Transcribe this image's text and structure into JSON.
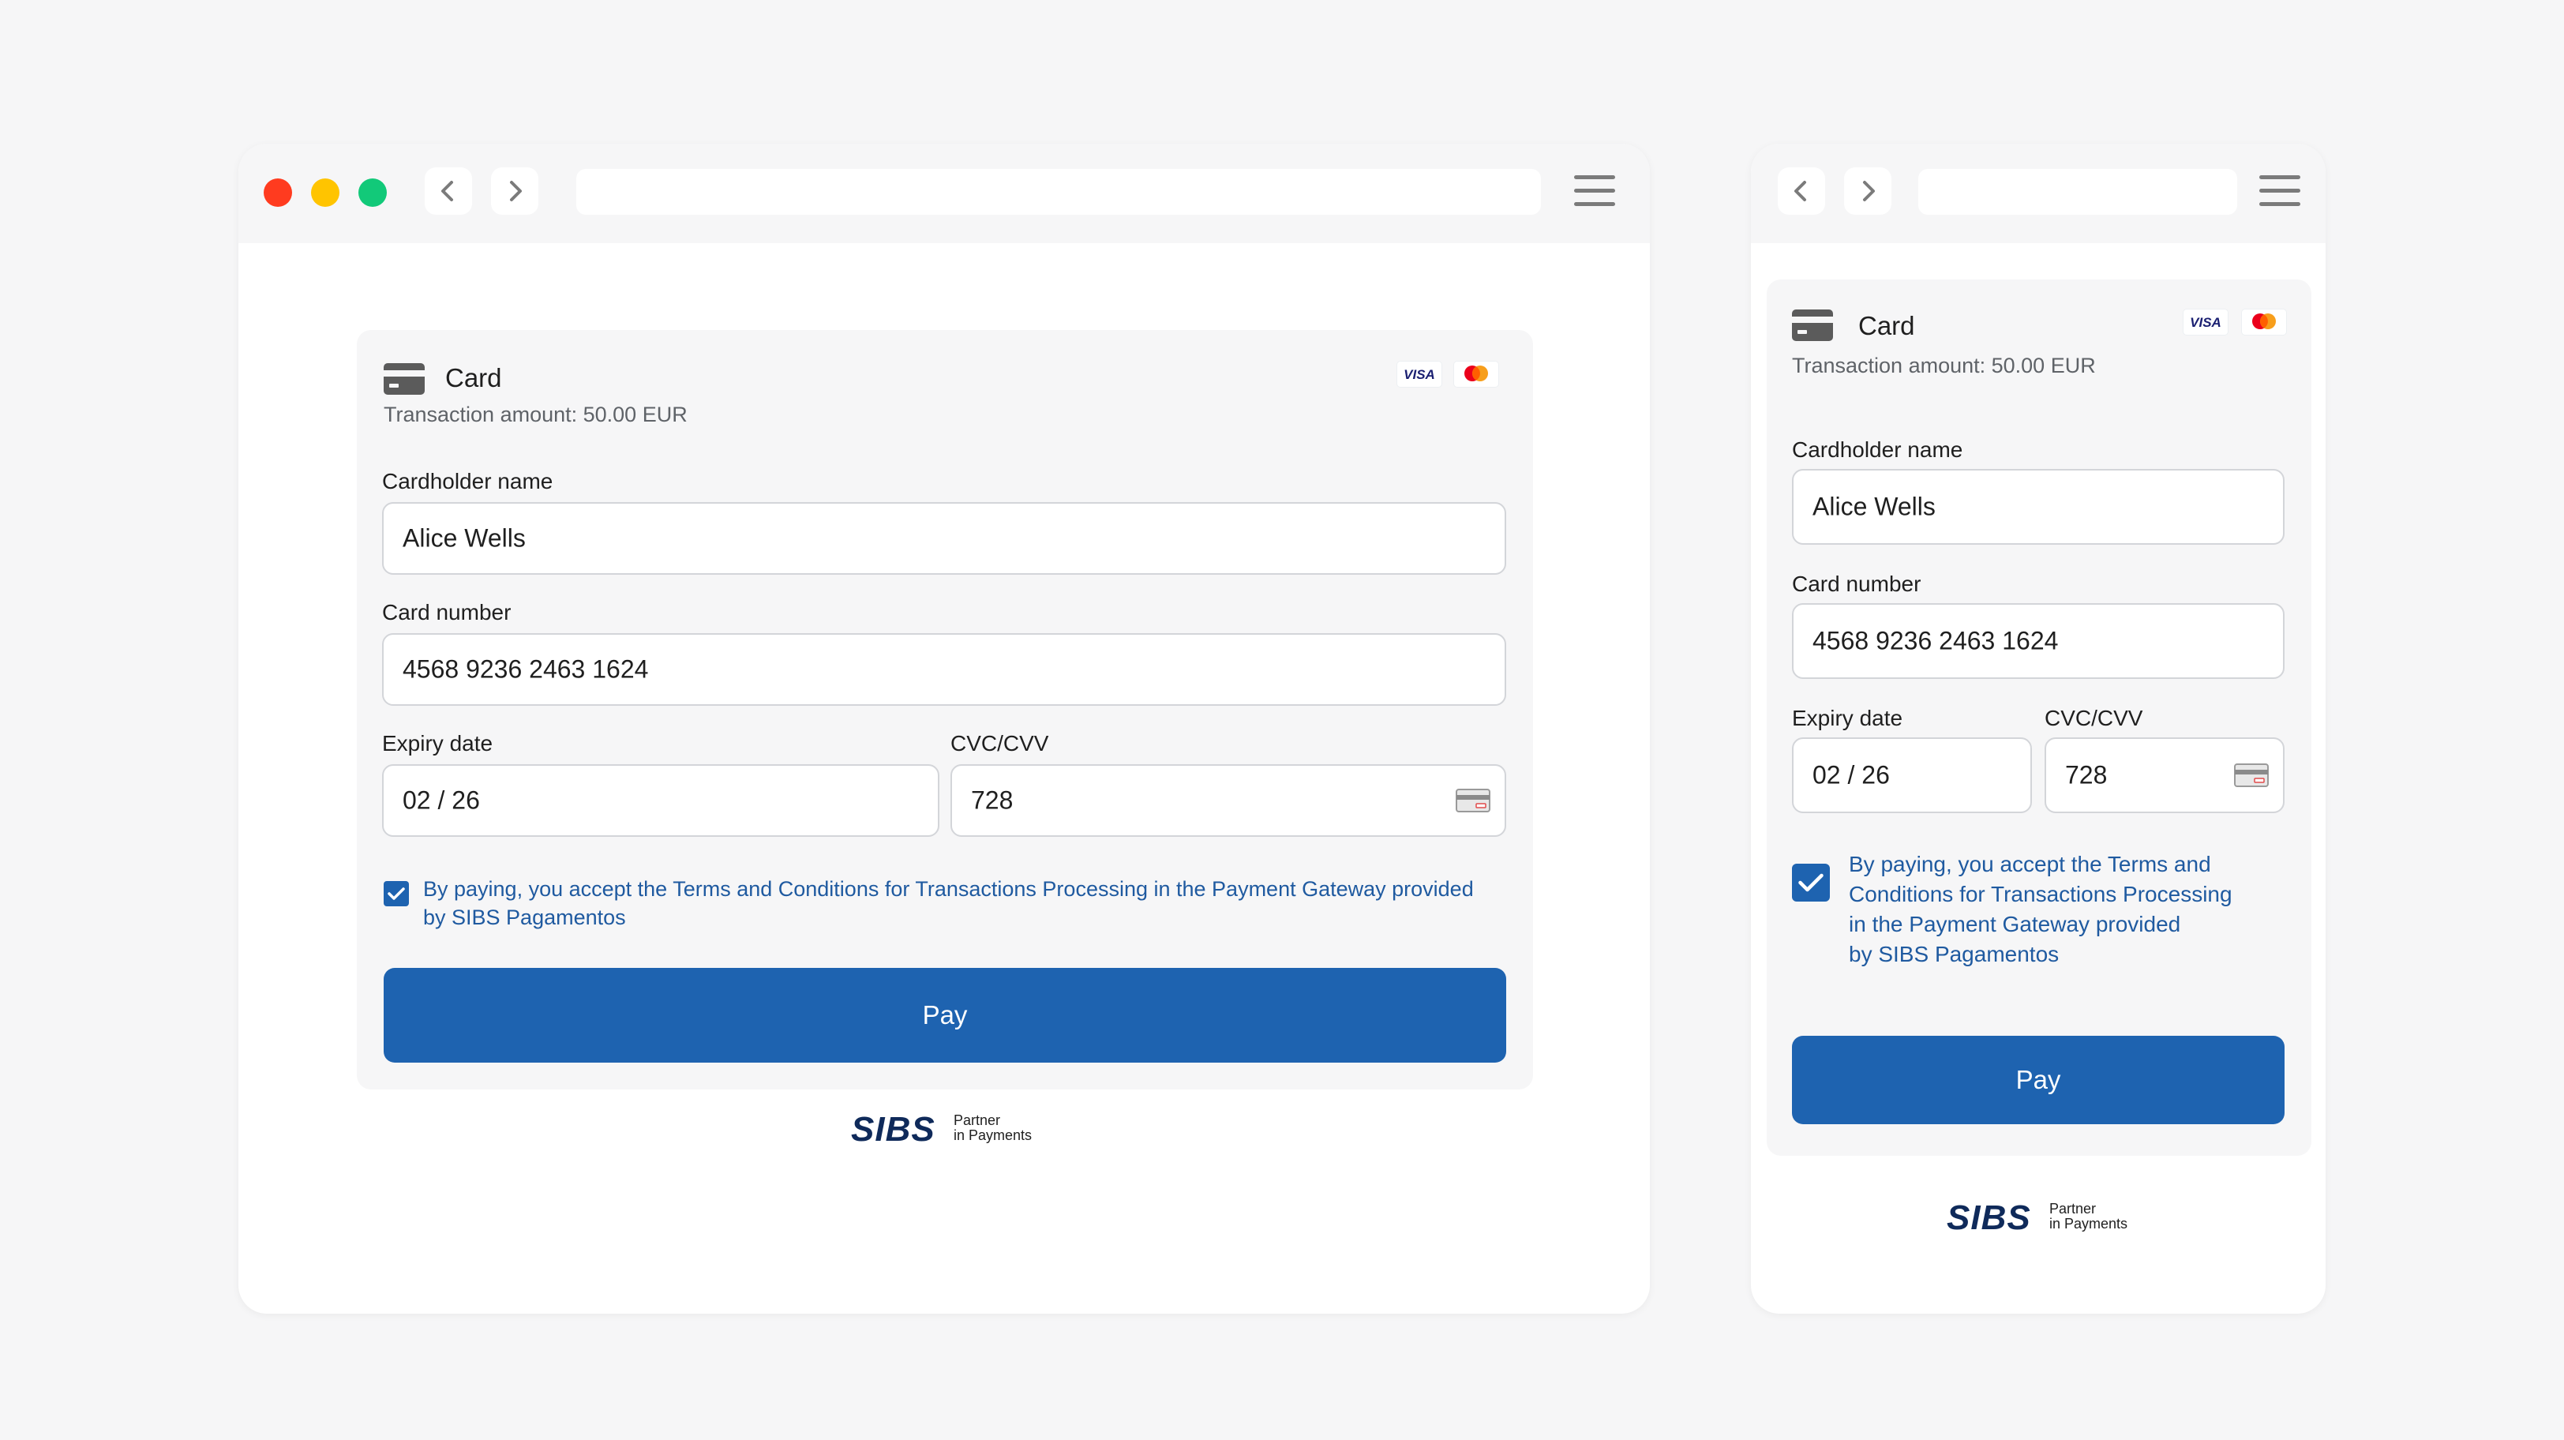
{
  "colors": {
    "background": "#f6f6f7",
    "accent": "#1e63b0",
    "close": "#ff3b1f",
    "minimize": "#ffc400",
    "maximize": "#12c979"
  },
  "icons": {
    "card": "credit-card-icon",
    "back": "chevron-left-icon",
    "forward": "chevron-right-icon",
    "menu": "hamburger-menu-icon",
    "cvv": "cvv-card-icon",
    "check": "check-icon"
  },
  "desktop": {
    "payment": {
      "title": "Card",
      "amount": "Transaction amount: 50.00 EUR",
      "visa": "VISA",
      "cardholder_label": "Cardholder name",
      "cardholder_value": "Alice Wells",
      "number_label": "Card number",
      "number_value": "4568 9236 2463 1624",
      "expiry_label": "Expiry date",
      "expiry_value": "02 / 26",
      "cvv_label": "CVC/CVV",
      "cvv_value": "728",
      "terms_checked": true,
      "terms_line1": "By paying, you accept the Terms and Conditions for Transactions Processing in the Payment Gateway provided",
      "terms_line2": "by SIBS Pagamentos",
      "pay_label": "Pay"
    },
    "footer": {
      "brand": "SIBS",
      "tag1": "Partner",
      "tag2": "in Payments"
    }
  },
  "mobile": {
    "payment": {
      "title": "Card",
      "amount": "Transaction amount: 50.00 EUR",
      "visa": "VISA",
      "cardholder_label": "Cardholder name",
      "cardholder_value": "Alice Wells",
      "number_label": "Card number",
      "number_value": "4568 9236 2463 1624",
      "expiry_label": "Expiry date",
      "expiry_value": "02 / 26",
      "cvv_label": "CVC/CVV",
      "cvv_value": "728",
      "terms_checked": true,
      "terms_lines": [
        "By paying, you accept the Terms and",
        "Conditions for Transactions Processing",
        "in the Payment Gateway provided",
        "by SIBS Pagamentos"
      ],
      "pay_label": "Pay"
    },
    "footer": {
      "brand": "SIBS",
      "tag1": "Partner",
      "tag2": "in Payments"
    }
  }
}
